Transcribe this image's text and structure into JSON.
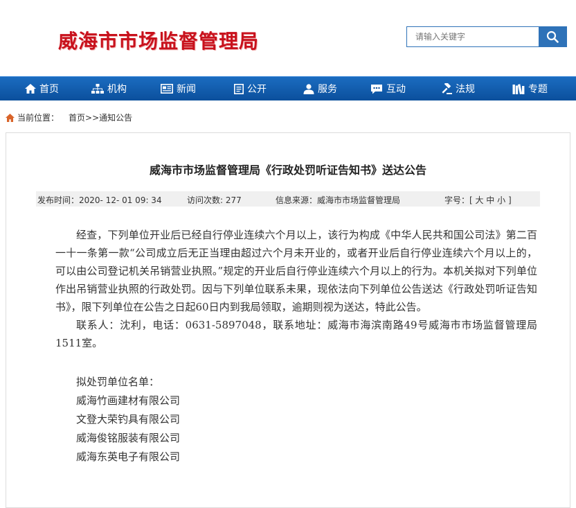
{
  "header": {
    "site_title": "威海市市场监督管理局",
    "search_placeholder": "请输入关键字"
  },
  "nav": {
    "items": [
      {
        "label": "首页",
        "icon": "home-icon"
      },
      {
        "label": "机构",
        "icon": "org-chart-icon"
      },
      {
        "label": "新闻",
        "icon": "newspaper-icon"
      },
      {
        "label": "公开",
        "icon": "document-icon"
      },
      {
        "label": "服务",
        "icon": "person-icon"
      },
      {
        "label": "互动",
        "icon": "chat-icon"
      },
      {
        "label": "法规",
        "icon": "gavel-icon"
      },
      {
        "label": "专题",
        "icon": "books-icon"
      }
    ]
  },
  "breadcrumb": {
    "prefix": "当前位置：",
    "home": "首页",
    "separator": ">>",
    "current": "通知公告"
  },
  "article": {
    "title": "威海市市场监督管理局《行政处罚听证告知书》送达公告",
    "meta": {
      "publish_time": "发布时间：2020- 12- 01 09: 34",
      "visits": "访问次数: 277",
      "source": "信息来源：威海市市场监督管理局",
      "font_size": "字号：[ 大 中 小 ]"
    },
    "paragraph": "经查，下列单位开业后已经自行停业连续六个月以上，该行为构成《中华人民共和国公司法》第二百一十一条第一款“公司成立后无正当理由超过六个月未开业的，或者开业后自行停业连续六个月以上的，可以由公司登记机关吊销营业执照。”规定的开业后自行停业连续六个月以上的行为。本机关拟对下列单位作出吊销营业执照的行政处罚。因与下列单位联系未果，现依法向下列单位公告送达《行政处罚听证告知书》，限下列单位在公告之日起60日内到我局领取，逾期则视为送达，特此公告。",
    "contact": "联系人：沈利，电话：0631-5897048，联系地址：威海市海滨南路49号威海市市场监督管理局1511室。",
    "list_title": "拟处罚单位名单：",
    "companies": [
      "威海竹画建材有限公司",
      "文登大荣钓具有限公司",
      "威海俊铭服装有限公司",
      "威海东英电子有限公司"
    ]
  },
  "colors": {
    "brand_red": "#c8111c",
    "nav_blue": "#0b4f9c",
    "search_blue": "#2e72b8"
  }
}
